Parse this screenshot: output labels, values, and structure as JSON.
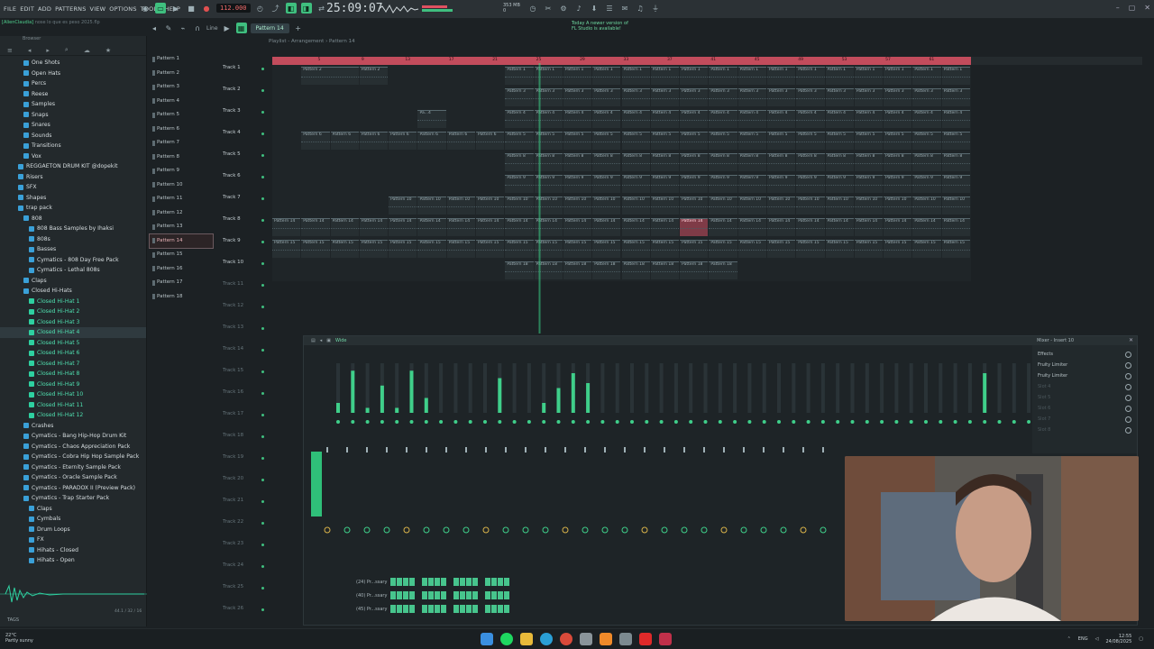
{
  "menu": [
    "FILE",
    "EDIT",
    "ADD",
    "PATTERNS",
    "VIEW",
    "OPTIONS",
    "TOOLS",
    "HELP"
  ],
  "hint": {
    "user": "[AlienClaudia]",
    "text": "nose lo que es peso 2025.flp"
  },
  "transport": {
    "tempo": "112.000",
    "timecode": "25:09:07"
  },
  "cpu": {
    "mem": "353 MB",
    "cores": "0"
  },
  "news": {
    "line1": "Today  A newer version of",
    "line2": "FL Studio is available!"
  },
  "toolbar2": {
    "pattern": "Pattern 14",
    "snap": "Line"
  },
  "playlist": {
    "title": "Playlist - Arrangement › Pattern 14"
  },
  "browser": {
    "title": "Browser",
    "items": [
      {
        "label": "One Shots",
        "kind": "folder",
        "indent": 1
      },
      {
        "label": "Open Hats",
        "kind": "folder",
        "indent": 1
      },
      {
        "label": "Percs",
        "kind": "folder",
        "indent": 1
      },
      {
        "label": "Reese",
        "kind": "folder",
        "indent": 1
      },
      {
        "label": "Samples",
        "kind": "folder",
        "indent": 1
      },
      {
        "label": "Snaps",
        "kind": "folder",
        "indent": 1
      },
      {
        "label": "Snares",
        "kind": "folder",
        "indent": 1
      },
      {
        "label": "Sounds",
        "kind": "folder",
        "indent": 1
      },
      {
        "label": "Transitions",
        "kind": "folder",
        "indent": 1
      },
      {
        "label": "Vox",
        "kind": "folder",
        "indent": 1
      },
      {
        "label": "REGGAETON DRUM KIT @dopekit",
        "kind": "folder",
        "indent": 0
      },
      {
        "label": "Risers",
        "kind": "folder",
        "indent": 0
      },
      {
        "label": "SFX",
        "kind": "folder",
        "indent": 0
      },
      {
        "label": "Shapes",
        "kind": "folder",
        "indent": 0
      },
      {
        "label": "trap pack",
        "kind": "folder",
        "indent": 0
      },
      {
        "label": "808",
        "kind": "folder",
        "indent": 1
      },
      {
        "label": "808 Bass Samples by Ihaksi",
        "kind": "folder",
        "indent": 2
      },
      {
        "label": "808s",
        "kind": "folder",
        "indent": 2
      },
      {
        "label": "Basses",
        "kind": "folder",
        "indent": 2
      },
      {
        "label": "Cymatics - 808 Day Free Pack",
        "kind": "folder",
        "indent": 2
      },
      {
        "label": "Cymatics - Lethal 808s",
        "kind": "folder",
        "indent": 2
      },
      {
        "label": "Claps",
        "kind": "folder",
        "indent": 1
      },
      {
        "label": "Closed Hi-Hats",
        "kind": "folder",
        "indent": 1
      },
      {
        "label": "Closed Hi-Hat 1",
        "kind": "sample",
        "indent": 2
      },
      {
        "label": "Closed Hi-Hat 2",
        "kind": "sample",
        "indent": 2
      },
      {
        "label": "Closed Hi-Hat 3",
        "kind": "sample",
        "indent": 2
      },
      {
        "label": "Closed Hi-Hat 4",
        "kind": "sample",
        "indent": 2,
        "selected": true
      },
      {
        "label": "Closed Hi-Hat 5",
        "kind": "sample",
        "indent": 2
      },
      {
        "label": "Closed Hi-Hat 6",
        "kind": "sample",
        "indent": 2
      },
      {
        "label": "Closed Hi-Hat 7",
        "kind": "sample",
        "indent": 2
      },
      {
        "label": "Closed Hi-Hat 8",
        "kind": "sample",
        "indent": 2
      },
      {
        "label": "Closed Hi-Hat 9",
        "kind": "sample",
        "indent": 2
      },
      {
        "label": "Closed Hi-Hat 10",
        "kind": "sample",
        "indent": 2
      },
      {
        "label": "Closed Hi-Hat 11",
        "kind": "sample",
        "indent": 2
      },
      {
        "label": "Closed Hi-Hat 12",
        "kind": "sample",
        "indent": 2
      },
      {
        "label": "Crashes",
        "kind": "folder",
        "indent": 1
      },
      {
        "label": "Cymatics - Bang Hip-Hop Drum Kit",
        "kind": "folder",
        "indent": 1
      },
      {
        "label": "Cymatics - Chaos Appreciation Pack",
        "kind": "folder",
        "indent": 1
      },
      {
        "label": "Cymatics - Cobra Hip Hop Sample Pack",
        "kind": "folder",
        "indent": 1
      },
      {
        "label": "Cymatics - Eternity Sample Pack",
        "kind": "folder",
        "indent": 1
      },
      {
        "label": "Cymatics - Oracle Sample Pack",
        "kind": "folder",
        "indent": 1
      },
      {
        "label": "Cymatics - PARADOX II (Preview Pack)",
        "kind": "folder",
        "indent": 1
      },
      {
        "label": "Cymatics - Trap Starter Pack",
        "kind": "folder",
        "indent": 1
      },
      {
        "label": "Claps",
        "kind": "folder",
        "indent": 2
      },
      {
        "label": "Cymbals",
        "kind": "folder",
        "indent": 2
      },
      {
        "label": "Drum Loops",
        "kind": "folder",
        "indent": 2
      },
      {
        "label": "FX",
        "kind": "folder",
        "indent": 2
      },
      {
        "label": "Hihats - Closed",
        "kind": "folder",
        "indent": 2
      },
      {
        "label": "Hihats - Open",
        "kind": "folder",
        "indent": 2
      }
    ],
    "bitrate": "44.1 / 32 / 16",
    "tags": "TAGS"
  },
  "patterns": [
    "Pattern 1",
    "Pattern 2",
    "Pattern 3",
    "Pattern 4",
    "Pattern 5",
    "Pattern 6",
    "Pattern 7",
    "Pattern 8",
    "Pattern 9",
    "Pattern 10",
    "Pattern 11",
    "Pattern 12",
    "Pattern 13",
    "Pattern 14",
    "Pattern 15",
    "Pattern 16",
    "Pattern 17",
    "Pattern 18"
  ],
  "current_pattern_index": 13,
  "tracks": [
    "Track 1",
    "Track 2",
    "Track 3",
    "Track 4",
    "Track 5",
    "Track 6",
    "Track 7",
    "Track 8",
    "Track 9",
    "Track 10",
    "Track 11",
    "Track 12",
    "Track 13",
    "Track 14",
    "Track 15",
    "Track 16",
    "Track 17",
    "Track 18",
    "Track 19",
    "Track 20",
    "Track 21",
    "Track 22",
    "Track 23",
    "Track 24",
    "Track 25",
    "Track 26"
  ],
  "ruler_marks": [
    "5",
    "9",
    "13",
    "17",
    "21",
    "25",
    "29",
    "33",
    "37",
    "41",
    "45",
    "49",
    "53",
    "57",
    "61"
  ],
  "clips": [
    {
      "track": 0,
      "start": 1,
      "len": 2,
      "label": "Pattern 2"
    },
    {
      "track": 0,
      "start": 3,
      "len": 1,
      "label": "Pattern 2"
    },
    {
      "track": 0,
      "start": 8,
      "len": 16,
      "label": "Pattern 1",
      "repeat": 16
    },
    {
      "track": 1,
      "start": 8,
      "len": 16,
      "label": "Pattern 3",
      "repeat": 16
    },
    {
      "track": 2,
      "start": 5,
      "len": 1,
      "label": "Pa...4"
    },
    {
      "track": 2,
      "start": 8,
      "len": 16,
      "label": "Pattern 4",
      "repeat": 16
    },
    {
      "track": 3,
      "start": 1,
      "len": 7,
      "label": "Pattern 6",
      "repeat": 7
    },
    {
      "track": 3,
      "start": 8,
      "len": 16,
      "label": "Pattern 5",
      "repeat": 16
    },
    {
      "track": 4,
      "start": 8,
      "len": 16,
      "label": "Pattern 8",
      "repeat": 16
    },
    {
      "track": 5,
      "start": 8,
      "len": 16,
      "label": "Pattern 9",
      "repeat": 16
    },
    {
      "track": 6,
      "start": 4,
      "len": 20,
      "label": "Pattern 10",
      "repeat": 20
    },
    {
      "track": 7,
      "start": 0,
      "len": 24,
      "label": "Pattern 14",
      "repeat": 24
    },
    {
      "track": 8,
      "start": 0,
      "len": 24,
      "label": "Pattern 15",
      "repeat": 24
    },
    {
      "track": 9,
      "start": 8,
      "len": 8,
      "label": "Pattern 18",
      "repeat": 8
    }
  ],
  "red_clip": {
    "track": 7,
    "start": 14,
    "len": 1,
    "label": "Pattern 14"
  },
  "mixer": {
    "title": "Mixer - Insert 10",
    "mode": "Wide",
    "slots": [
      "Effects",
      "Fruity Limiter",
      "Fruity Limiter",
      "Slot 4",
      "Slot 5",
      "Slot 6",
      "Slot 7",
      "Slot 8"
    ],
    "meter_levels": [
      0.2,
      0.85,
      0.1,
      0.55,
      0.1,
      0.85,
      0.3,
      0,
      0,
      0,
      0,
      0.7,
      0,
      0,
      0.2,
      0.5,
      0.8,
      0.6,
      0,
      0,
      0,
      0,
      0,
      0,
      0,
      0,
      0,
      0,
      0,
      0,
      0,
      0,
      0,
      0,
      0,
      0,
      0,
      0,
      0,
      0,
      0,
      0,
      0,
      0,
      0.8,
      0,
      0,
      0,
      0
    ],
    "master_meter": 0.9,
    "channels": [
      {
        "name": "(24) Pr...ssary",
        "steps": [
          1,
          1,
          1,
          1,
          0,
          1,
          1,
          1,
          1,
          0,
          1,
          1,
          1,
          1,
          0,
          1,
          1,
          1,
          1
        ]
      },
      {
        "name": "(40) Pr...ssary",
        "steps": [
          1,
          1,
          1,
          1,
          0,
          1,
          1,
          1,
          1,
          0,
          1,
          1,
          1,
          1,
          0,
          1,
          1,
          1,
          1
        ]
      },
      {
        "name": "(45) Pr...ssary",
        "steps": [
          1,
          1,
          1,
          1,
          0,
          1,
          1,
          1,
          1,
          0,
          1,
          1,
          1,
          1,
          0,
          1,
          1,
          1,
          1
        ]
      }
    ]
  },
  "taskbar": {
    "weather_temp": "22°C",
    "weather_desc": "Partly sunny",
    "lang": "ENG",
    "time": "12:55",
    "date": "24/08/2025"
  },
  "colors": {
    "accent": "#3fbf7f",
    "ruler": "#c24c5c",
    "selected_clip": "#c8465a",
    "folder": "#3aa0d8",
    "sample": "#2ed0a0"
  }
}
